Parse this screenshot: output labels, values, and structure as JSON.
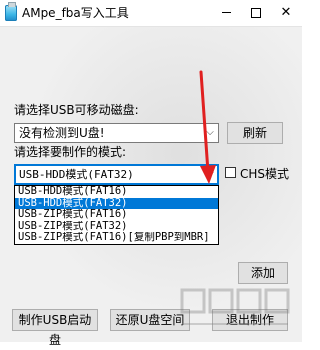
{
  "window": {
    "title": "AMpe_fba写入工具",
    "minimize_label": "—",
    "maximize_label": "□",
    "close_label": "✕"
  },
  "usb_section": {
    "label": "请选择USB可移动磁盘:",
    "disk_select_value": "没有检测到U盘!",
    "refresh_button": "刷新"
  },
  "mode_section": {
    "label": "请选择要制作的模式:",
    "mode_select_value": "USB-HDD模式(FAT32)",
    "chs_label": "CHS模式",
    "chs_checked": false,
    "options": [
      "USB-HDD模式(FAT16)",
      "USB-HDD模式(FAT32)",
      "USB-ZIP模式(FAT16)",
      "USB-ZIP模式(FAT32)",
      "USB-ZIP模式(FAT16)[复制PBP到MBR]"
    ],
    "selected_index": 1
  },
  "add_button": "添加",
  "actions": {
    "make_button": "制作USB启动盘",
    "restore_button": "还原U盘空间",
    "exit_button": "退出制作"
  },
  "colors": {
    "selection": "#0078d7",
    "annotation_arrow": "#e02020",
    "client_bg": "#f0f0f0"
  },
  "icons": {
    "app": "usb-drive-icon",
    "dropdown": "chevron-down-icon",
    "annotation": "red-arrow-icon",
    "watermark": "watermark-logo"
  }
}
